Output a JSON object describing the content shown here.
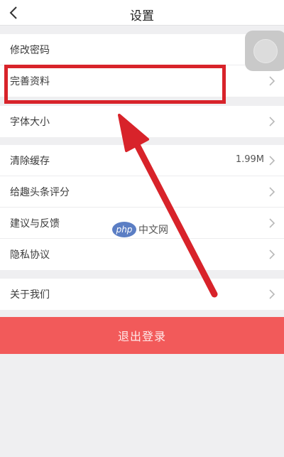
{
  "header": {
    "title": "设置"
  },
  "sections": [
    {
      "items": [
        {
          "label": "修改密码"
        },
        {
          "label": "完善资料"
        }
      ]
    },
    {
      "items": [
        {
          "label": "字体大小"
        }
      ]
    },
    {
      "items": [
        {
          "label": "清除缓存",
          "value": "1.99M"
        },
        {
          "label": "给趣头条评分"
        },
        {
          "label": "建议与反馈"
        },
        {
          "label": "隐私协议"
        }
      ]
    },
    {
      "items": [
        {
          "label": "关于我们"
        }
      ]
    }
  ],
  "logout_label": "退出登录",
  "watermark": {
    "logo_text": "php",
    "text": "中文网"
  },
  "colors": {
    "accent": "#f25a5a",
    "annotation": "#d8232a"
  }
}
